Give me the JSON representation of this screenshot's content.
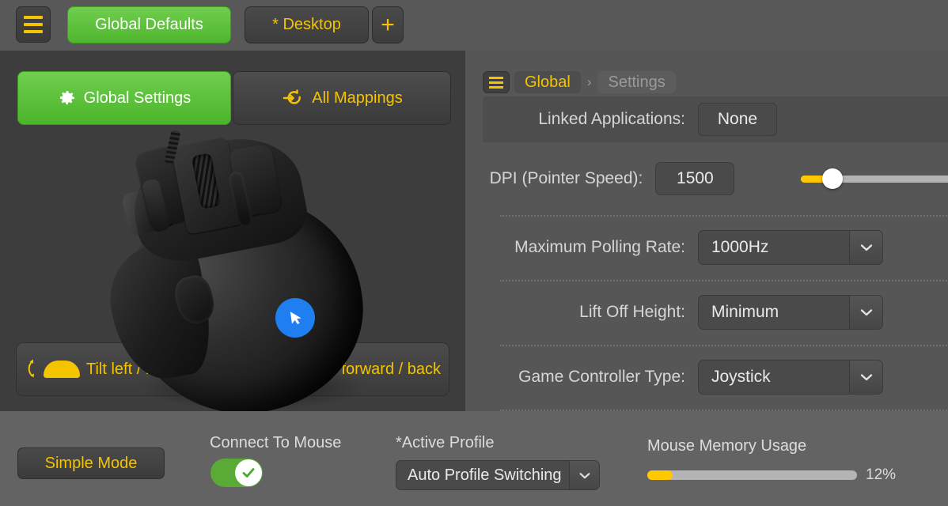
{
  "topbar": {
    "menu_icon": "hamburger-icon",
    "tabs": [
      {
        "label": "Global Defaults",
        "state": "active"
      },
      {
        "label": "* Desktop",
        "state": "inactive"
      }
    ],
    "add_tab_label": "+"
  },
  "left_panel": {
    "mode_buttons": [
      {
        "label": "Global Settings",
        "icon": "gear-icon",
        "state": "active"
      },
      {
        "label": "All Mappings",
        "icon": "enter-arrow-icon",
        "state": "inactive"
      }
    ],
    "device_image": "gaming-mouse-render",
    "tilt_hint": {
      "icon": "mouse-tilt-icon",
      "left_text": "Tilt left / right",
      "right_text": "Scroll forward / back",
      "right_text_visible": "orward / back"
    }
  },
  "right_panel": {
    "breadcrumb": {
      "menu_icon": "hamburger-icon",
      "items": [
        {
          "label": "Global",
          "state": "active"
        },
        {
          "label": "Settings",
          "state": "dim"
        }
      ],
      "separator": "›"
    },
    "settings": [
      {
        "label": "Linked Applications:",
        "value": "None",
        "control": "button",
        "highlight": true
      },
      {
        "label": "DPI (Pointer Speed):",
        "value": "1500",
        "control": "number-with-slider",
        "slider_percent": 12
      },
      {
        "label": "Maximum Polling Rate:",
        "value": "1000Hz",
        "control": "select"
      },
      {
        "label": "Lift Off Height:",
        "value": "Minimum",
        "control": "select"
      },
      {
        "label": "Game Controller Type:",
        "value": "Joystick",
        "control": "select"
      }
    ]
  },
  "bottom_bar": {
    "simple_mode_label": "Simple Mode",
    "connect_label": "Connect To Mouse",
    "connect_state": "on",
    "active_profile_label": "*Active Profile",
    "active_profile_value": "Auto Profile Switching",
    "memory_label": "Mouse Memory Usage",
    "memory_percent_text": "12%",
    "memory_percent": 12
  },
  "colors": {
    "accent_yellow": "#f5c400",
    "accent_green": "#5ec23d",
    "panel_dark": "#3d3d3d",
    "panel_light": "#565656",
    "bottom_bar": "#636363",
    "logo_blue": "#1f7ff0"
  }
}
